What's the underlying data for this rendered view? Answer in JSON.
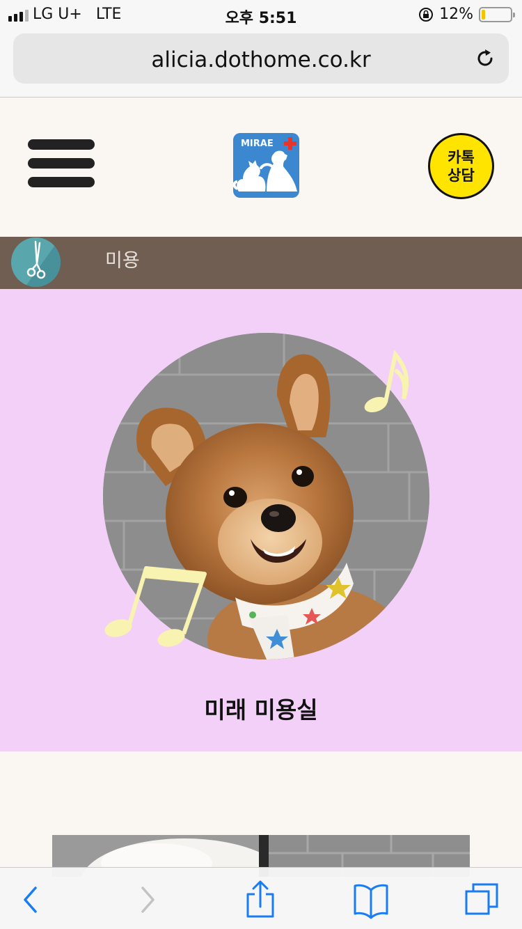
{
  "status_bar": {
    "carrier": "LG U+",
    "network": "LTE",
    "time": "오후 5:51",
    "battery_percent": "12%",
    "battery_level": 0.12,
    "orientation_lock_icon": "orientation-lock-icon"
  },
  "browser": {
    "url": "alicia.dothome.co.kr",
    "reload_icon": "reload-icon"
  },
  "site_header": {
    "menu_icon": "hamburger-icon",
    "logo_text": "MIRAE",
    "kakao_line1": "카톡",
    "kakao_line2": "상담"
  },
  "category": {
    "icon": "scissors-icon",
    "label": "미용"
  },
  "hero": {
    "title": "미래 미용실",
    "image": "pomeranian-photo"
  },
  "toolbar": {
    "back_icon": "chevron-left-icon",
    "forward_icon": "chevron-right-icon",
    "share_icon": "share-icon",
    "bookmarks_icon": "book-icon",
    "tabs_icon": "tabs-icon"
  },
  "colors": {
    "page_bg": "#faf6f2",
    "category_bar": "#705e52",
    "hero_bg": "#f2d0f8",
    "kakao_yellow": "#ffe400",
    "logo_blue": "#3b87d0",
    "ios_blue": "#1a7cf5"
  }
}
